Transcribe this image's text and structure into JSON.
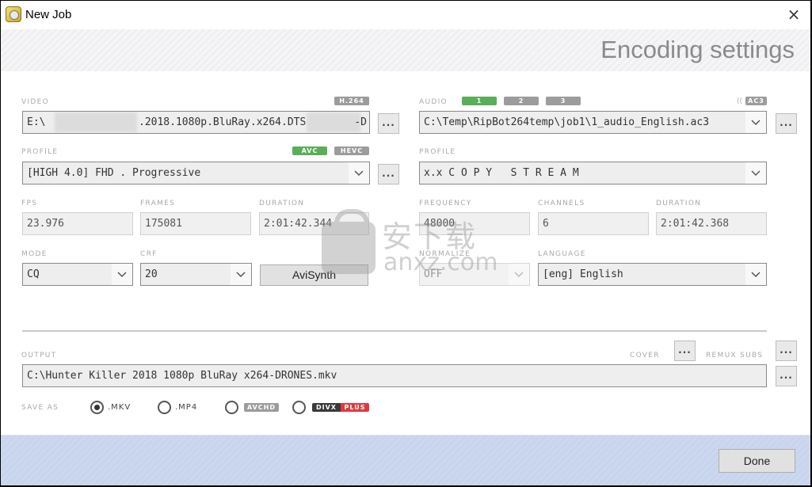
{
  "window": {
    "title": "New Job",
    "close_icon": "×"
  },
  "header": {
    "title": "Encoding settings"
  },
  "video": {
    "label": "VIDEO",
    "codec_badge": "H.264",
    "path_prefix": "E:\\",
    "path_middle": ".2018.1080p.BluRay.x264.DTS.",
    "path_suffix": "-D",
    "browse_label": "...",
    "profile_label": "PROFILE",
    "profile_badges": [
      {
        "label": "AVC",
        "active": true
      },
      {
        "label": "HEVC",
        "active": false
      }
    ],
    "profile_value": "[HIGH 4.0] FHD . Progressive",
    "profile_browse_label": "...",
    "fps_label": "FPS",
    "fps_value": "23.976",
    "frames_label": "FRAMES",
    "frames_value": "175081",
    "duration_label": "DURATION",
    "duration_value": "2:01:42.344",
    "mode_label": "MODE",
    "mode_value": "CQ",
    "crf_label": "CRF",
    "crf_value": "20",
    "avisynth_label": "AviSynth"
  },
  "audio": {
    "label": "AUDIO",
    "tracks": [
      {
        "label": "1",
        "active": true
      },
      {
        "label": "2",
        "active": false
      },
      {
        "label": "3",
        "active": false
      }
    ],
    "codec_prefix": "((",
    "codec_badge": "AC3",
    "path_value": "C:\\Temp\\RipBot264temp\\job1\\1_audio_English.ac3",
    "browse_label": "...",
    "profile_label": "PROFILE",
    "profile_value": "x.x C O P Y   S T R E A M",
    "frequency_label": "FREQUENCY",
    "frequency_value": "48000",
    "channels_label": "CHANNELS",
    "channels_value": "6",
    "duration_label": "DURATION",
    "duration_value": "2:01:42.368",
    "normalize_label": "NORMALIZE",
    "normalize_value": "OFF",
    "language_label": "LANGUAGE",
    "language_value": "[eng] English"
  },
  "output": {
    "label": "OUTPUT",
    "cover_label": "COVER",
    "cover_button": "...",
    "remux_subs_label": "REMUX SUBS",
    "remux_subs_button": "...",
    "path_value": "C:\\Hunter Killer 2018 1080p BluRay x264-DRONES.mkv",
    "browse_label": "...",
    "save_as_label": "SAVE AS",
    "formats": [
      {
        "label": ".MKV",
        "selected": true
      },
      {
        "label": ".MP4",
        "selected": false
      },
      {
        "label": "AVCHD",
        "selected": false
      },
      {
        "label_a": "DIVX",
        "label_b": "PLUS",
        "selected": false
      }
    ]
  },
  "footer": {
    "done_label": "Done"
  },
  "watermark": {
    "text_cn": "安下载",
    "text_en": "anxz.com"
  },
  "colors": {
    "accent_green": "#5aae5a",
    "badge_gray": "#9c9c9c",
    "divx_dark": "#3a3a3a",
    "divx_red": "#e0393e",
    "footer_blue": "#c9d6ee"
  }
}
